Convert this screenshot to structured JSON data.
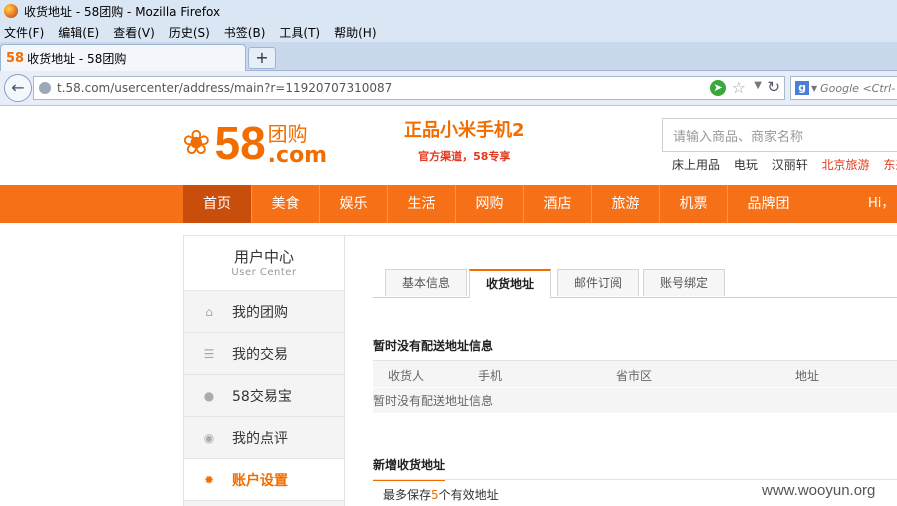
{
  "browser": {
    "window_title": "收货地址 - 58团购 - Mozilla Firefox",
    "menu": [
      "文件(F)",
      "编辑(E)",
      "查看(V)",
      "历史(S)",
      "书签(B)",
      "工具(T)",
      "帮助(H)"
    ],
    "tab_favicon_text": "58",
    "tab_title": "收货地址 - 58团购",
    "new_tab_symbol": "+",
    "url": "t.58.com/usercenter/address/main?r=11920707310087",
    "search_placeholder": "Google <Ctrl-"
  },
  "header": {
    "logo_number": "58",
    "logo_tuan": "团购",
    "logo_com": ".com",
    "promo_line1": "正品小米手机2",
    "promo_line2": "官方渠道，58专享",
    "search_placeholder": "请输入商品、商家名称",
    "hot_links": [
      "床上用品",
      "电玩",
      "汉丽轩",
      "北京旅游",
      "东来"
    ]
  },
  "nav": {
    "items": [
      "首页",
      "美食",
      "娱乐",
      "生活",
      "网购",
      "酒店",
      "旅游",
      "机票",
      "品牌团"
    ],
    "greeting": "Hi，"
  },
  "sidebar": {
    "title": "用户中心",
    "subtitle": "User Center",
    "items": [
      {
        "label": "我的团购",
        "icon": "home-icon"
      },
      {
        "label": "我的交易",
        "icon": "list-icon"
      },
      {
        "label": "58交易宝",
        "icon": "coin-icon"
      },
      {
        "label": "我的点评",
        "icon": "comment-icon"
      },
      {
        "label": "账户设置",
        "icon": "gear-icon"
      }
    ]
  },
  "content": {
    "tabs": [
      "基本信息",
      "收货地址",
      "邮件订阅",
      "账号绑定"
    ],
    "section1_title": "暂时没有配送地址信息",
    "columns": [
      "收货人",
      "手机",
      "省市区",
      "地址"
    ],
    "empty_text": "暂时没有配送地址信息",
    "section2_title": "新增收货地址",
    "max_note_prefix": "最多保存",
    "max_note_num": "5",
    "max_note_suffix": "个有效地址"
  },
  "watermark": "www.wooyun.org",
  "colors": {
    "accent": "#f26d00",
    "nav": "#f57016",
    "nav_active": "#c94e0c"
  }
}
